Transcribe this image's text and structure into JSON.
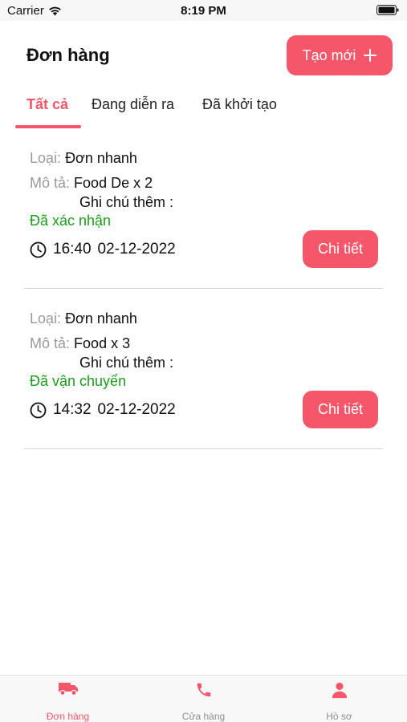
{
  "status_bar": {
    "carrier": "Carrier",
    "time": "8:19 PM"
  },
  "header": {
    "title": "Đơn hàng",
    "create_label": "Tạo mới",
    "create_icon": "plus-icon"
  },
  "tabs": [
    {
      "label": "Tất cả",
      "active": true
    },
    {
      "label": "Đang diễn ra",
      "active": false
    },
    {
      "label": "Đã khởi tạo",
      "active": false
    }
  ],
  "orders": [
    {
      "type_label": "Loại:",
      "type_value": "Đơn nhanh",
      "desc_label": "Mô tả:",
      "desc_value": "Food De x 2",
      "note": "Ghi chú thêm :",
      "status": "Đã xác nhận",
      "time": "16:40",
      "date": "02-12-2022",
      "detail_label": "Chi tiết"
    },
    {
      "type_label": "Loại:",
      "type_value": "Đơn nhanh",
      "desc_label": "Mô tả:",
      "desc_value": "Food x 3",
      "note": "Ghi chú thêm :",
      "status": "Đã vận chuyển",
      "time": "14:32",
      "date": "02-12-2022",
      "detail_label": "Chi tiết"
    }
  ],
  "bottom_nav": [
    {
      "label": "Đơn hàng",
      "icon": "truck-icon",
      "active": true
    },
    {
      "label": "Cửa hàng",
      "icon": "phone-icon",
      "active": false
    },
    {
      "label": "Hồ sơ",
      "icon": "person-icon",
      "active": false
    }
  ],
  "colors": {
    "accent": "#f5566a",
    "status_green": "#1a9e1a",
    "label_gray": "#9a9a9a"
  }
}
